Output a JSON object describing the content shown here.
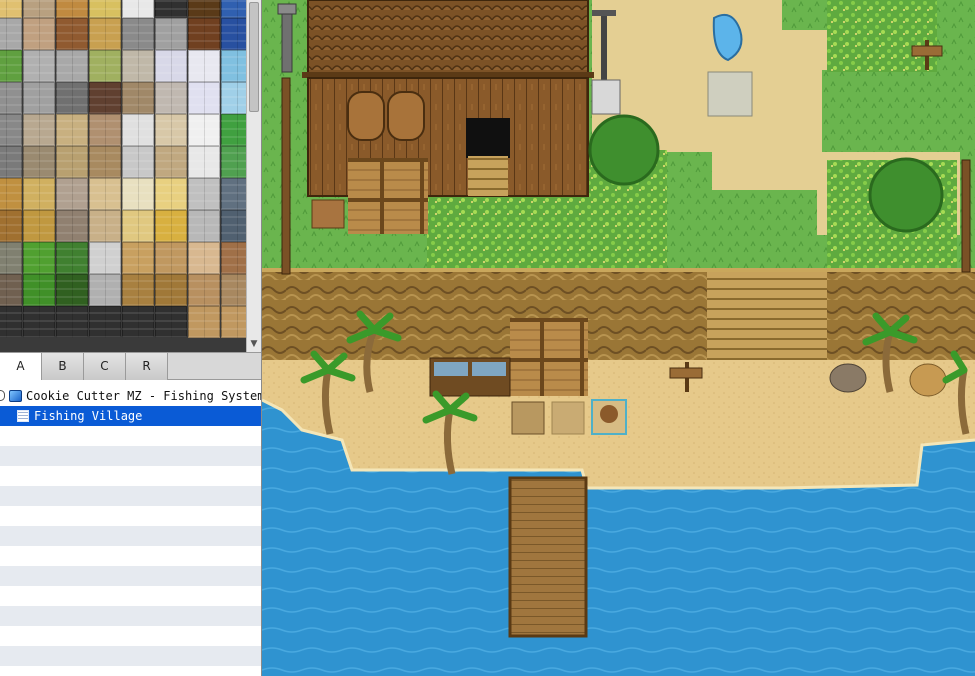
{
  "tileset": {
    "tabs": [
      {
        "label": "A",
        "active": true
      },
      {
        "label": "B",
        "active": false
      },
      {
        "label": "C",
        "active": false
      },
      {
        "label": "R",
        "active": false
      }
    ]
  },
  "map_tree": {
    "project": "Cookie Cutter MZ - Fishing System",
    "maps": [
      {
        "name": "Fishing Village",
        "selected": true
      }
    ]
  },
  "colors": {
    "selection": "#0a5bd6",
    "water": "#2f93d0",
    "sand": "#e6c98a",
    "grass": "#6ab54e",
    "cliff": "#9a7636",
    "wood": "#8a5a2a"
  },
  "icons": [
    "expander-icon",
    "project-icon",
    "map-icon",
    "scroll-down-icon"
  ]
}
